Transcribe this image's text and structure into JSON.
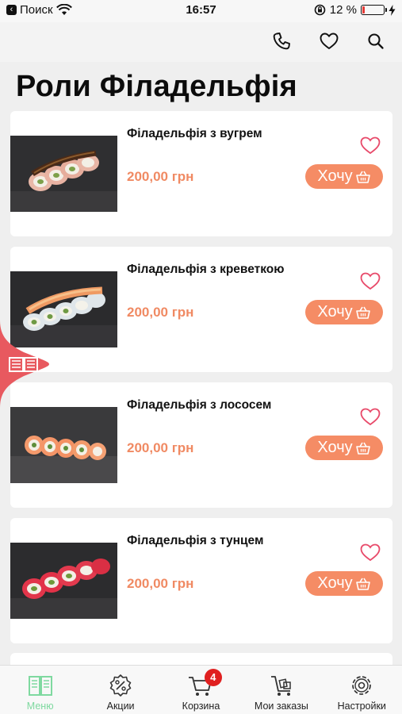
{
  "status_bar": {
    "carrier": "Поиск",
    "time": "16:57",
    "battery": "12 %",
    "battery_level": 0.12
  },
  "top_bar": {
    "icons": [
      "phone-icon",
      "heart-icon",
      "search-icon"
    ]
  },
  "page": {
    "title": "Роли Філадельфія"
  },
  "products": [
    {
      "name": "Філадельфія з вугрем",
      "price": "200,00 грн",
      "button": "Хочу"
    },
    {
      "name": "Філадельфія з креветкою",
      "price": "200,00 грн",
      "button": "Хочу"
    },
    {
      "name": "Філадельфія з лососем",
      "price": "200,00 грн",
      "button": "Хочу"
    },
    {
      "name": "Філадельфія з тунцем",
      "price": "200,00 грн",
      "button": "Хочу"
    }
  ],
  "bottom_nav": {
    "items": [
      {
        "label": "Меню",
        "icon": "menu-book-icon",
        "active": true
      },
      {
        "label": "Акции",
        "icon": "discount-icon",
        "active": false
      },
      {
        "label": "Корзина",
        "icon": "cart-icon",
        "active": false,
        "badge": "4"
      },
      {
        "label": "Мои заказы",
        "icon": "orders-cart-icon",
        "active": false
      },
      {
        "label": "Настройки",
        "icon": "gear-icon",
        "active": false
      }
    ]
  },
  "colors": {
    "accent": "#f58c65",
    "price": "#f08a63",
    "favorite": "#e84a6a",
    "side_tab": "#e8595f",
    "active_nav": "#7fd9a0",
    "badge": "#e02020"
  }
}
